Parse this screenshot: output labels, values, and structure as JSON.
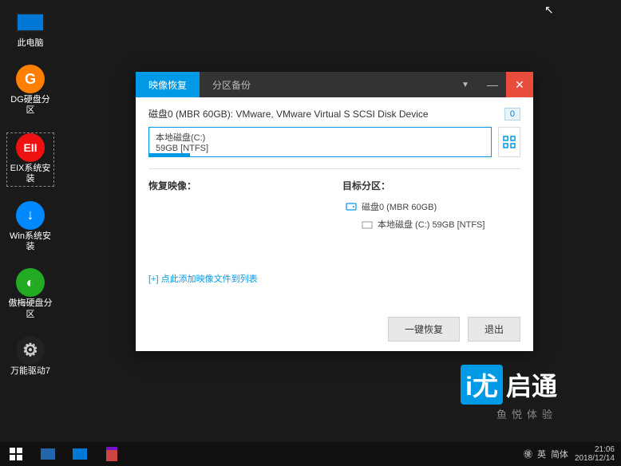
{
  "desktop": {
    "icons": [
      {
        "label": "此电脑",
        "type": "monitor"
      },
      {
        "label": "DG硬盘分区",
        "type": "orange",
        "glyph": "G"
      },
      {
        "label": "EIX系统安装",
        "type": "red",
        "glyph": "EII",
        "selected": true
      },
      {
        "label": "Win系统安装",
        "type": "blue",
        "glyph": "↓"
      },
      {
        "label": "傲梅硬盘分区",
        "type": "green",
        "glyph": "◐"
      },
      {
        "label": "万能驱动7",
        "type": "gear",
        "glyph": ""
      }
    ]
  },
  "window": {
    "tabs": {
      "active": "映像恢复",
      "inactive": "分区备份"
    },
    "disk_info": "磁盘0 (MBR 60GB): VMware, VMware Virtual S SCSI Disk Device",
    "badge": "0",
    "partition": {
      "name": "本地磁盘(C:)",
      "size": "59GB [NTFS]"
    },
    "col1_title": "恢复映像：",
    "col2_title": "目标分区：",
    "tree": {
      "root": "磁盘0 (MBR 60GB)",
      "child": "本地磁盘 (C:) 59GB [NTFS]"
    },
    "add_link": "[+] 点此添加映像文件到列表",
    "btn_restore": "一键恢复",
    "btn_exit": "退出"
  },
  "watermark": {
    "brand_box": "i尤",
    "brand_text": "启通",
    "sub": "鱼悦体验"
  },
  "taskbar": {
    "lang1": "英",
    "lang2": "简体",
    "time": "21:06",
    "date": "2018/12/14"
  }
}
